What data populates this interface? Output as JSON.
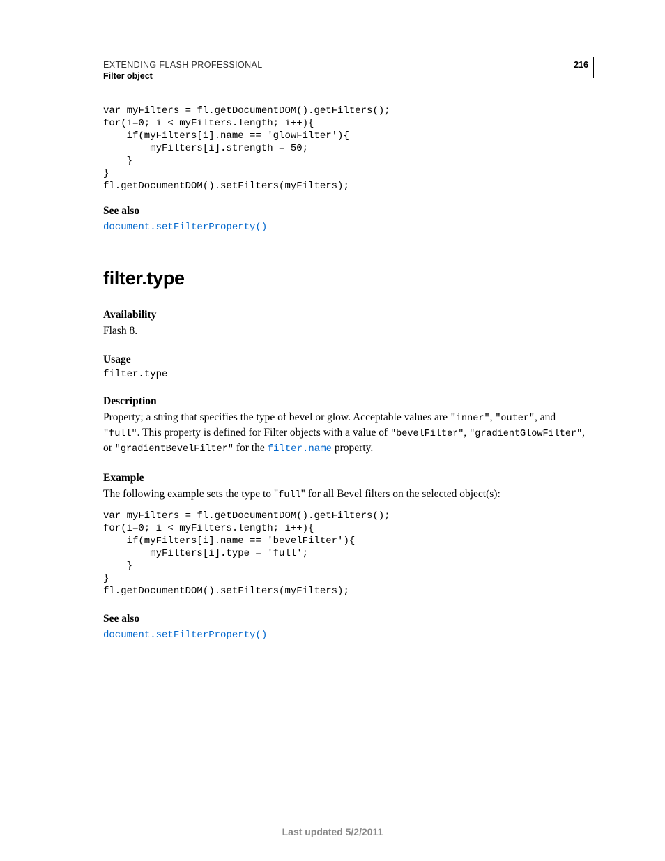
{
  "header": {
    "line1": "EXTENDING FLASH PROFESSIONAL",
    "line2": "Filter object",
    "page_number": "216"
  },
  "code_block_1": "var myFilters = fl.getDocumentDOM().getFilters();\nfor(i=0; i < myFilters.length; i++){\n    if(myFilters[i].name == 'glowFilter'){\n        myFilters[i].strength = 50;\n    }\n}\nfl.getDocumentDOM().setFilters(myFilters);",
  "see_also_1": {
    "label": "See also",
    "link": "document.setFilterProperty()"
  },
  "section_title": "filter.type",
  "availability": {
    "label": "Availability",
    "text": "Flash 8."
  },
  "usage": {
    "label": "Usage",
    "code": "filter.type"
  },
  "description": {
    "label": "Description",
    "p1_a": "Property; a string that specifies the type of bevel or glow. Acceptable values are ",
    "p1_code1": "\"inner\"",
    "p1_b": ", ",
    "p1_code2": "\"outer\"",
    "p1_c": ", and ",
    "p1_code3": "\"full\"",
    "p1_d": ". This property is defined for Filter objects with a value of ",
    "p1_code4": "\"bevelFilter\"",
    "p1_e": ", ",
    "p1_code5": "\"gradientGlowFilter\"",
    "p1_f": ", or ",
    "p1_code6": "\"gradientBevelFilter\"",
    "p1_g": " for the ",
    "p1_link": "filter.name",
    "p1_h": " property."
  },
  "example": {
    "label": "Example",
    "intro_a": "The following example sets the type to \"",
    "intro_code": "full",
    "intro_b": "\" for all Bevel filters on the selected object(s):",
    "code": "var myFilters = fl.getDocumentDOM().getFilters();\nfor(i=0; i < myFilters.length; i++){\n    if(myFilters[i].name == 'bevelFilter'){\n        myFilters[i].type = 'full';\n    }\n}\nfl.getDocumentDOM().setFilters(myFilters);"
  },
  "see_also_2": {
    "label": "See also",
    "link": "document.setFilterProperty()"
  },
  "footer": "Last updated 5/2/2011"
}
